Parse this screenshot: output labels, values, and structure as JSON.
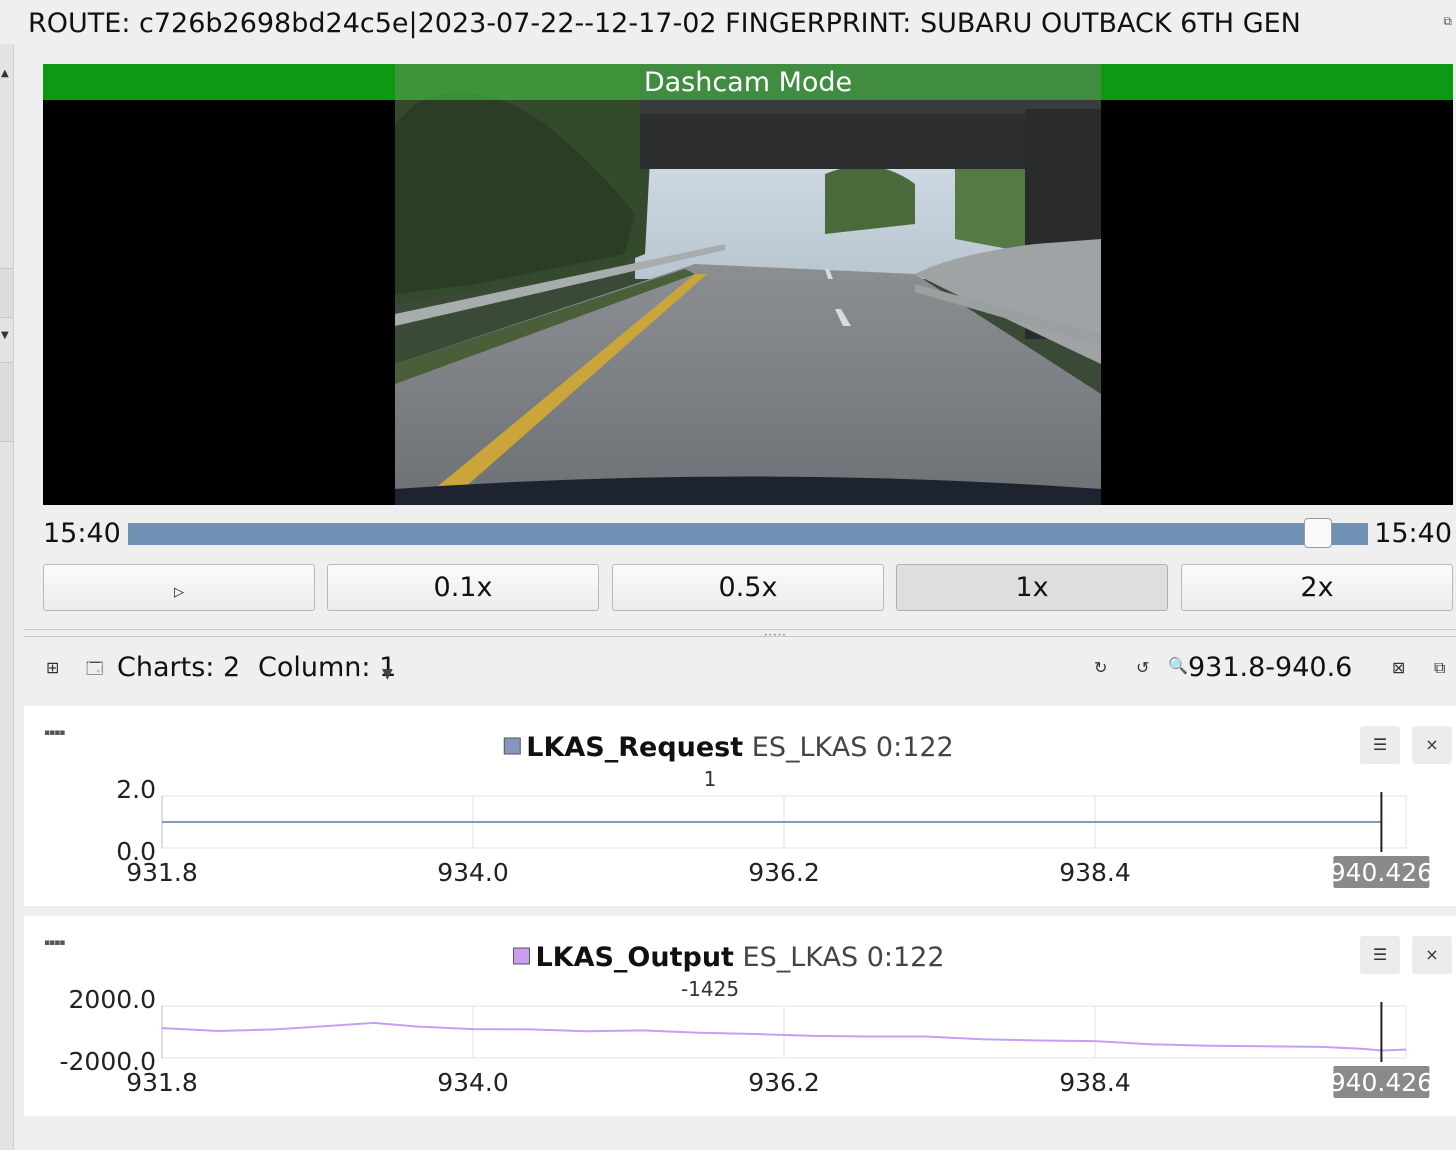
{
  "header": {
    "route_text": "ROUTE: c726b2698bd24c5e|2023-07-22--12-17-02  FINGERPRINT: SUBARU OUTBACK 6TH GEN"
  },
  "video": {
    "banner_label": "Dashcam Mode",
    "banner_color": "#0c9a14"
  },
  "timeline": {
    "start_time": "15:40",
    "end_time": "15:40",
    "progress": 0.96
  },
  "playback": {
    "play_icon": "play-icon",
    "play_glyph": "▷",
    "speeds": [
      "0.1x",
      "0.5x",
      "1x",
      "2x"
    ],
    "active_speed": "1x"
  },
  "toolbar": {
    "charts_label": "Charts: 2",
    "column_label": "Column: 1",
    "zoom_range": "931.8-940.6",
    "icons": [
      "new-chart-icon",
      "tabs-icon",
      "undo-zoom-icon",
      "redo-zoom-icon",
      "zoom-icon",
      "remove-all-icon",
      "dock-icon"
    ]
  },
  "chart_data": [
    {
      "type": "line",
      "series": [
        {
          "name": "LKAS_Request",
          "color": "#8796c0",
          "x": [
            931.8,
            940.426
          ],
          "values": [
            1,
            1
          ]
        }
      ],
      "title_name": "LKAS_Request",
      "title_suffix": "ES_LKAS 0:122",
      "current_value": "1",
      "cursor_label": "940.426",
      "x_ticks": [
        "931.8",
        "934.0",
        "936.2",
        "938.4"
      ],
      "y_ticks": [
        "2.0",
        "0.0"
      ],
      "xlim": [
        931.8,
        940.6
      ],
      "ylim": [
        0,
        2
      ],
      "grid": true,
      "cursor_x": 940.426
    },
    {
      "type": "line",
      "series": [
        {
          "name": "LKAS_Output",
          "color": "#c89ef0",
          "x": [
            931.8,
            932.2,
            932.6,
            933.0,
            933.3,
            933.6,
            934.0,
            934.4,
            934.8,
            935.2,
            935.6,
            936.0,
            936.4,
            936.8,
            937.2,
            937.6,
            938.0,
            938.4,
            938.8,
            939.2,
            939.6,
            940.0,
            940.3,
            940.426,
            940.6
          ],
          "values": [
            300,
            80,
            200,
            480,
            700,
            420,
            220,
            200,
            60,
            120,
            -60,
            -150,
            -300,
            -350,
            -350,
            -550,
            -650,
            -700,
            -950,
            -1050,
            -1100,
            -1150,
            -1300,
            -1425,
            -1350
          ]
        }
      ],
      "title_name": "LKAS_Output",
      "title_suffix": "ES_LKAS 0:122",
      "current_value": "-1425",
      "cursor_label": "940.426",
      "x_ticks": [
        "931.8",
        "934.0",
        "936.2",
        "938.4"
      ],
      "y_ticks": [
        "2000.0",
        "-2000.0"
      ],
      "xlim": [
        931.8,
        940.6
      ],
      "ylim": [
        -2000,
        2000
      ],
      "grid": true,
      "cursor_x": 940.426
    }
  ]
}
